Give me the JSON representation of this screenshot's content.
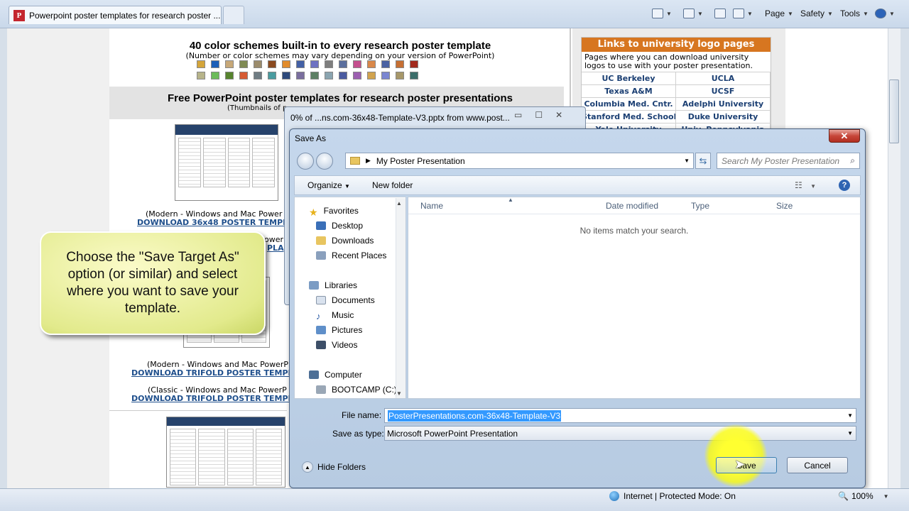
{
  "browser": {
    "tab_title": "Powerpoint poster templates for research poster ...",
    "favicon_letter": "P",
    "toolbar": {
      "page": "Page",
      "safety": "Safety",
      "tools": "Tools"
    }
  },
  "page": {
    "color_heading": "40 color schemes built-in to every research poster template",
    "color_sub": "(Number or color schemes may vary depending on your version of PowerPoint)",
    "swatches_row1": [
      "#d4a53a",
      "#1c5fb8",
      "#c7a878",
      "#7f8a54",
      "#9b8c6c",
      "#8b4a1f",
      "#e18b2b",
      "#4360a6",
      "#6e72c2",
      "#7e7e7e",
      "#5b6f9e",
      "#c44f8e",
      "#d9884a",
      "#4b62a3",
      "#c66f33",
      "#a22a1d"
    ],
    "swatches_row2": [
      "#b7b48a",
      "#6cbb5a",
      "#57842e",
      "#d65b34",
      "#6f7c83",
      "#4a9ca0",
      "#2e4a7c",
      "#7a6e9e",
      "#5d7f64",
      "#8aa4b0",
      "#4a5ba0",
      "#9c5fb0",
      "#d1a34e",
      "#7b86d1",
      "#a79769",
      "#3c6e6a"
    ],
    "free_heading": "Free PowerPoint poster templates for research poster presentations",
    "free_sub": "(Thumbnails of p",
    "caption1": "(Modern - Windows and Mac Power",
    "download1": "DOWNLOAD 36x48 POSTER TEMPLA",
    "download1b": "PLA",
    "caption1b": "owerP",
    "caption2": "(Modern - Windows and Mac PowerP",
    "download2": "DOWNLOAD TRIFOLD POSTER TEMPLA",
    "caption3": "(Classic - Windows and Mac PowerP",
    "download3": "DOWNLOAD TRIFOLD POSTER TEMPLA"
  },
  "links": {
    "heading": "Links to university logo pages",
    "desc": "Pages where you can download university logos to use with your poster presentation.",
    "rows": [
      [
        "UC Berkeley",
        "UCLA"
      ],
      [
        "Texas A&M",
        "UCSF"
      ],
      [
        "Columbia Med. Cntr.",
        "Adelphi University"
      ],
      [
        "Stanford Med. School",
        "Duke University"
      ],
      [
        "Yale University",
        "Univ. Pennsylvania"
      ]
    ]
  },
  "download_window": {
    "title": "0% of ...ns.com-36x48-Template-V3.pptx from www.post..."
  },
  "callout": {
    "text": "Choose the \"Save Target As\" option (or similar) and select where you want to save your template."
  },
  "dialog": {
    "title": "Save As",
    "close": "✕",
    "address": "My Poster Presentation",
    "search_placeholder": "Search My Poster Presentation",
    "organize": "Organize",
    "new_folder": "New folder",
    "nav": {
      "favorites": "Favorites",
      "desktop": "Desktop",
      "downloads": "Downloads",
      "recent": "Recent Places",
      "libraries": "Libraries",
      "documents": "Documents",
      "music": "Music",
      "pictures": "Pictures",
      "videos": "Videos",
      "computer": "Computer",
      "bootcamp": "BOOTCAMP (C:)"
    },
    "columns": {
      "name": "Name",
      "date": "Date modified",
      "type": "Type",
      "size": "Size"
    },
    "empty_text": "No items match your search.",
    "file_name_label": "File name:",
    "file_name_value": "PosterPresentations.com-36x48-Template-V3",
    "save_type_label": "Save as type:",
    "save_type_value": "Microsoft PowerPoint Presentation",
    "hide_folders": "Hide Folders",
    "save_button": "Save",
    "cancel_button": "Cancel"
  },
  "status": {
    "zone": "Internet | Protected Mode: On",
    "zoom": "100%"
  },
  "colors": {
    "accent_orange": "#d77620",
    "link_blue": "#1f4f8c",
    "dialog_blue": "#c5d7ec",
    "callout_yellow": "#e2ea8c",
    "highlight": "#ffff30"
  }
}
